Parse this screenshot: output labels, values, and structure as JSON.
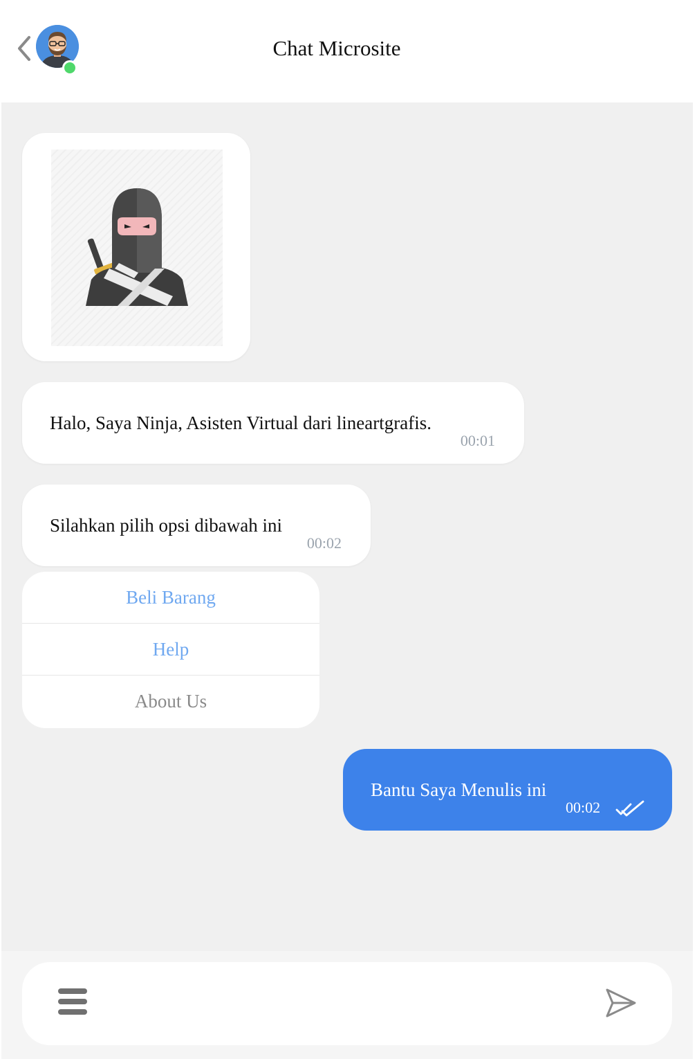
{
  "header": {
    "title": "Chat Microsite",
    "back_icon": "chevron-left-icon",
    "avatar_status": "online",
    "online_color": "#4fd86b"
  },
  "messages": [
    {
      "type": "image",
      "from": "bot",
      "image": "ninja-avatar-illustration"
    },
    {
      "type": "text",
      "from": "bot",
      "text": "Halo, Saya Ninja, Asisten Virtual dari lineartgrafis.",
      "time": "00:01"
    },
    {
      "type": "text",
      "from": "bot",
      "text": "Silahkan pilih opsi dibawah ini",
      "time": "00:02"
    }
  ],
  "options": [
    {
      "label": "Beli Barang",
      "color": "#6fa8f0"
    },
    {
      "label": "Help",
      "color": "#6fa8f0"
    },
    {
      "label": "About Us",
      "color": "#8a8a8a"
    }
  ],
  "sent_message": {
    "text": "Bantu Saya Menulis ini",
    "time": "00:02",
    "status": "read",
    "status_icon": "double-check-icon",
    "bubble_color": "#3d82ea"
  },
  "footer": {
    "menu_icon": "hamburger-menu-icon",
    "input_value": "",
    "input_placeholder": "",
    "send_icon": "send-icon"
  }
}
